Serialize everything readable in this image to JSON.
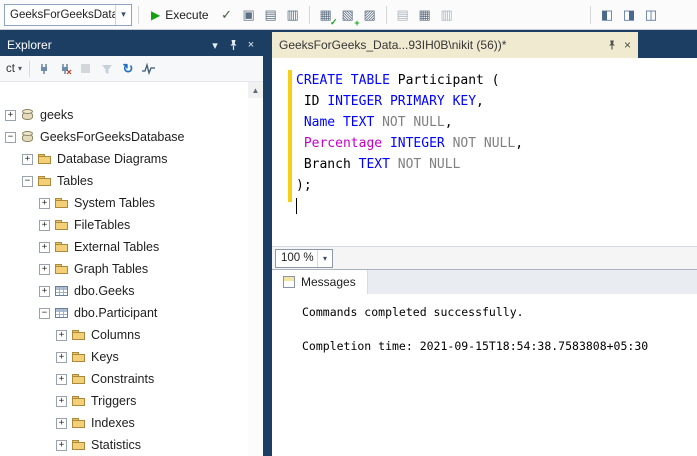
{
  "icons": {
    "combo_caret": "▾",
    "header_caret": "▾",
    "execute_play": "▶",
    "parse_check": "✓",
    "query_options": "▣",
    "intellisense": "▤",
    "template_params": "▥",
    "analyze_query": "▦",
    "exec_plan": "▧",
    "live_stats": "▨",
    "results_text": "▤",
    "results_grid": "▦",
    "results_file": "▥",
    "env_pane_left": "◧",
    "env_pane_right": "◨",
    "env_pane_split": "◫",
    "close": "×",
    "refresh": "↻",
    "scroll_up": "▲",
    "overlay_plus": "+",
    "overlay_check": "✓"
  },
  "toolbar": {
    "database_combo_value": "GeeksForGeeksDatabase",
    "execute_label": "Execute"
  },
  "explorer": {
    "title": "Explorer",
    "connect_label": "ct",
    "tree": {
      "items": [
        {
          "label": "geeks",
          "icon": "db",
          "expander": "plus",
          "level": 0
        },
        {
          "label": "GeeksForGeeksDatabase",
          "icon": "db",
          "expander": "minus",
          "level": 0
        },
        {
          "label": "Database Diagrams",
          "icon": "folder",
          "expander": "plus",
          "level": 1
        },
        {
          "label": "Tables",
          "icon": "folder",
          "expander": "minus",
          "level": 1
        },
        {
          "label": "System Tables",
          "icon": "folder",
          "expander": "plus",
          "level": 2
        },
        {
          "label": "FileTables",
          "icon": "folder",
          "expander": "plus",
          "level": 2
        },
        {
          "label": "External Tables",
          "icon": "folder",
          "expander": "plus",
          "level": 2
        },
        {
          "label": "Graph Tables",
          "icon": "folder",
          "expander": "plus",
          "level": 2
        },
        {
          "label": "dbo.Geeks",
          "icon": "table",
          "expander": "plus",
          "level": 2
        },
        {
          "label": "dbo.Participant",
          "icon": "table",
          "expander": "minus",
          "level": 2
        },
        {
          "label": "Columns",
          "icon": "folder",
          "expander": "plus",
          "level": 3
        },
        {
          "label": "Keys",
          "icon": "folder",
          "expander": "plus",
          "level": 3
        },
        {
          "label": "Constraints",
          "icon": "folder",
          "expander": "plus",
          "level": 3
        },
        {
          "label": "Triggers",
          "icon": "folder",
          "expander": "plus",
          "level": 3
        },
        {
          "label": "Indexes",
          "icon": "folder",
          "expander": "plus",
          "level": 3
        },
        {
          "label": "Statistics",
          "icon": "folder",
          "expander": "plus",
          "level": 3
        }
      ]
    }
  },
  "editor": {
    "tab_title": "GeeksForGeeks_Data...93IH0B\\nikit (56))*",
    "zoom_value": "100 %",
    "colors": {
      "kw": "#0000ff",
      "pl": "#000000",
      "gy": "#808080",
      "mg": "#c400c4"
    },
    "code_lines": [
      [
        {
          "t": "CREATE",
          "c": "kw"
        },
        {
          "t": " ",
          "c": "pl"
        },
        {
          "t": "TABLE",
          "c": "kw"
        },
        {
          "t": " Participant (",
          "c": "pl"
        }
      ],
      [
        {
          "t": " ID ",
          "c": "pl"
        },
        {
          "t": "INTEGER",
          "c": "kw"
        },
        {
          "t": " ",
          "c": "pl"
        },
        {
          "t": "PRIMARY",
          "c": "kw"
        },
        {
          "t": " ",
          "c": "pl"
        },
        {
          "t": "KEY",
          "c": "kw"
        },
        {
          "t": ",",
          "c": "pl"
        }
      ],
      [
        {
          "t": " ",
          "c": "pl"
        },
        {
          "t": "Name",
          "c": "kw"
        },
        {
          "t": " ",
          "c": "pl"
        },
        {
          "t": "TEXT",
          "c": "kw"
        },
        {
          "t": " ",
          "c": "pl"
        },
        {
          "t": "NOT NULL",
          "c": "gy"
        },
        {
          "t": ",",
          "c": "pl"
        }
      ],
      [
        {
          "t": " ",
          "c": "pl"
        },
        {
          "t": "Percentage",
          "c": "mg"
        },
        {
          "t": " ",
          "c": "pl"
        },
        {
          "t": "INTEGER",
          "c": "kw"
        },
        {
          "t": " ",
          "c": "pl"
        },
        {
          "t": "NOT NULL",
          "c": "gy"
        },
        {
          "t": ",",
          "c": "pl"
        }
      ],
      [
        {
          "t": " Branch ",
          "c": "pl"
        },
        {
          "t": "TEXT",
          "c": "kw"
        },
        {
          "t": " ",
          "c": "pl"
        },
        {
          "t": "NOT NULL",
          "c": "gy"
        }
      ],
      [
        {
          "t": ");",
          "c": "pl"
        }
      ]
    ]
  },
  "messages": {
    "tab_label": "Messages",
    "lines": [
      "Commands completed successfully.",
      "",
      "Completion time: 2021-09-15T18:54:38.7583808+05:30"
    ]
  }
}
